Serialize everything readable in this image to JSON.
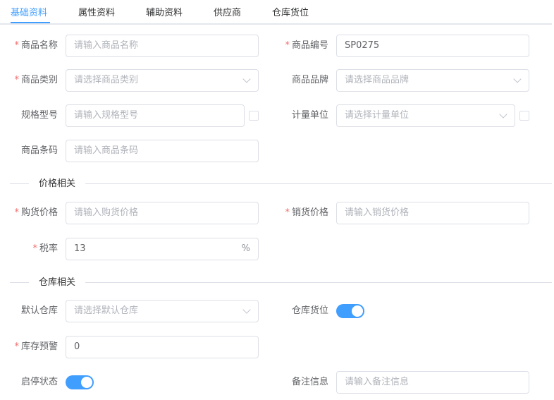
{
  "tabs": [
    "基础资料",
    "属性资料",
    "辅助资料",
    "供应商",
    "仓库货位"
  ],
  "fields": {
    "product_name": {
      "label": "商品名称",
      "required": true,
      "placeholder": "请输入商品名称"
    },
    "product_code": {
      "label": "商品编号",
      "required": true,
      "value": "SP0275"
    },
    "product_category": {
      "label": "商品类别",
      "required": true,
      "placeholder": "请选择商品类别"
    },
    "product_brand": {
      "label": "商品品牌",
      "required": false,
      "placeholder": "请选择商品品牌"
    },
    "spec_model": {
      "label": "规格型号",
      "required": false,
      "placeholder": "请输入规格型号"
    },
    "unit": {
      "label": "计量单位",
      "required": false,
      "placeholder": "请选择计量单位"
    },
    "barcode": {
      "label": "商品条码",
      "required": false,
      "placeholder": "请输入商品条码"
    },
    "purchase_price": {
      "label": "购货价格",
      "required": true,
      "placeholder": "请输入购货价格"
    },
    "sale_price": {
      "label": "销货价格",
      "required": true,
      "placeholder": "请输入销货价格"
    },
    "tax_rate": {
      "label": "税率",
      "required": true,
      "value": "13",
      "suffix": "%"
    },
    "default_warehouse": {
      "label": "默认仓库",
      "required": false,
      "placeholder": "请选择默认仓库"
    },
    "warehouse_location": {
      "label": "仓库货位",
      "required": false,
      "toggle_on": true
    },
    "stock_alert": {
      "label": "库存预警",
      "required": true,
      "value": "0"
    },
    "enabled_status": {
      "label": "启停状态",
      "required": false,
      "toggle_on": true
    },
    "remarks": {
      "label": "备注信息",
      "required": false,
      "placeholder": "请输入备注信息"
    }
  },
  "sections": {
    "price": "价格相关",
    "warehouse": "仓库相关"
  },
  "required_mark": "*",
  "colors": {
    "accent": "#409eff",
    "required": "#f56c6c",
    "border": "#dcdfe6"
  }
}
